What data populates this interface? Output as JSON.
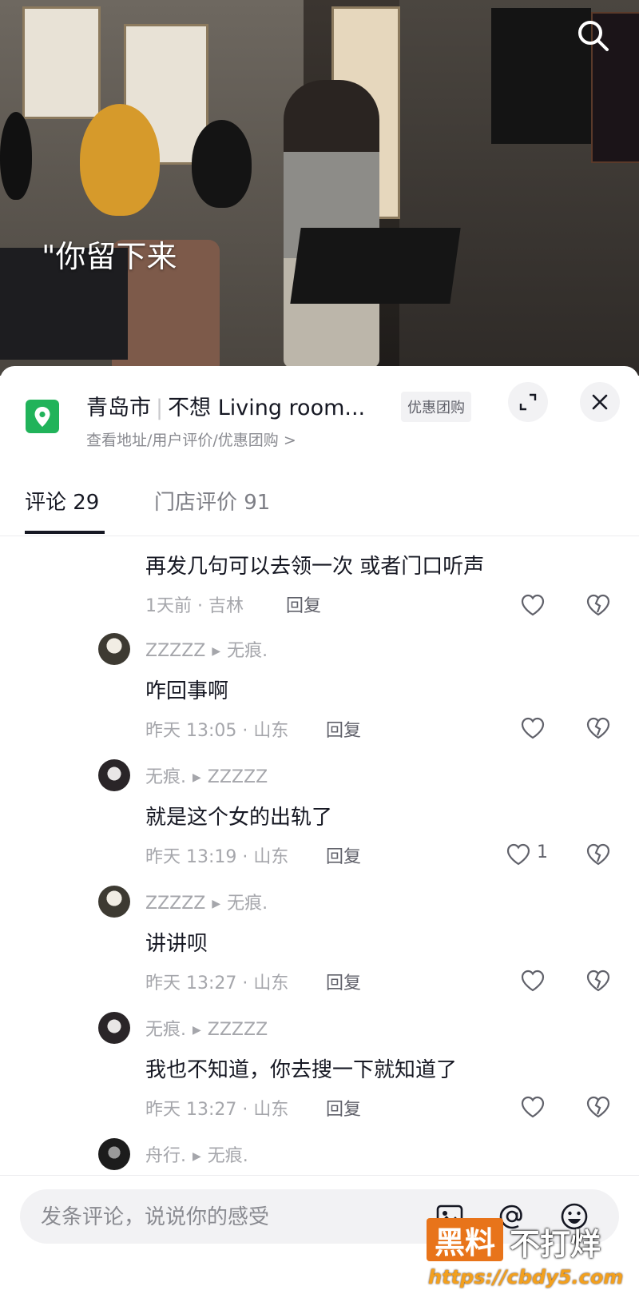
{
  "video": {
    "overlay_text": "\"你留下来",
    "search_icon": "search-icon"
  },
  "store": {
    "city": "青岛市",
    "name": "不想 Living room...",
    "deal_tag": "优惠团购",
    "subtitle": "查看地址/用户评价/优惠团购 >",
    "pin_icon": "location-pin-icon",
    "pin_color": "#21b35a"
  },
  "tabs": [
    {
      "label": "评论 29",
      "active": true
    },
    {
      "label": "门店评价 91",
      "active": false
    }
  ],
  "comments": [
    {
      "users": null,
      "text": "再发几句可以去领一次 或者门口听声",
      "meta": "1天前 · 吉林",
      "reply": "回复",
      "likes": ""
    },
    {
      "from": "ZZZZZ",
      "to": "无痕.",
      "text": "咋回事啊",
      "meta": "昨天 13:05 · 山东",
      "reply": "回复",
      "likes": ""
    },
    {
      "from": "无痕.",
      "to": "ZZZZZ",
      "text": "就是这个女的出轨了",
      "meta": "昨天 13:19 · 山东",
      "reply": "回复",
      "likes": "1"
    },
    {
      "from": "ZZZZZ",
      "to": "无痕.",
      "text": "讲讲呗",
      "meta": "昨天 13:27 · 山东",
      "reply": "回复",
      "likes": ""
    },
    {
      "from": "无痕.",
      "to": "ZZZZZ",
      "text": "我也不知道，你去搜一下就知道了",
      "meta": "昨天 13:27 · 山东",
      "reply": "回复",
      "likes": ""
    },
    {
      "from": "舟行.",
      "to": "无痕."
    }
  ],
  "input": {
    "placeholder": "发条评论，说说你的感受"
  },
  "watermark": {
    "box": "黑料",
    "text": "不打烊",
    "url": "https://cbdy5.com"
  }
}
